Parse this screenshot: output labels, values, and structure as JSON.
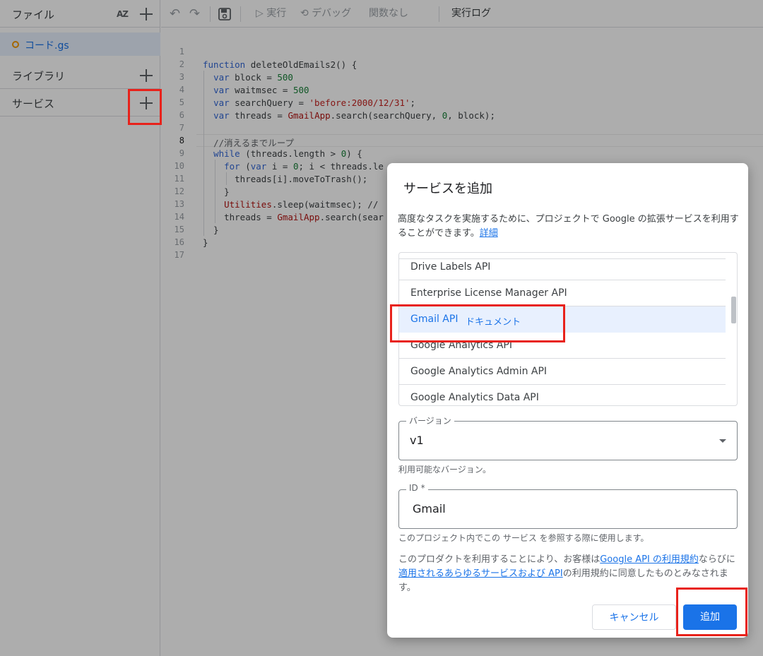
{
  "sidebar": {
    "files_title": "ファイル",
    "sort_icon": "AZ",
    "file_name": "コード.gs",
    "libraries_title": "ライブラリ",
    "services_title": "サービス"
  },
  "toolbar": {
    "run_label": "実行",
    "debug_label": "デバッグ",
    "function_label": "関数なし",
    "log_label": "実行ログ"
  },
  "editor": {
    "line_numbers": [
      "1",
      "2",
      "3",
      "4",
      "5",
      "6",
      "7",
      "8",
      "9",
      "10",
      "11",
      "12",
      "13",
      "14",
      "15",
      "16",
      "17"
    ]
  },
  "dialog": {
    "title": "サービスを追加",
    "description": "高度なタスクを実施するために、プロジェクトで Google の拡張サービスを利用することができます。",
    "details_link": "詳細",
    "apis": [
      "Drive Labels API",
      "Enterprise License Manager API",
      "Gmail API",
      "Google Analytics API",
      "Google Analytics Admin API",
      "Google Analytics Data API"
    ],
    "selected_doc_link": "ドキュメント",
    "version_label": "バージョン",
    "version_value": "v1",
    "version_helper": "利用可能なバージョン。",
    "id_label": "ID *",
    "id_value": "Gmail",
    "id_helper": "このプロジェクト内でこの サービス を参照する際に使用します。",
    "terms_prefix": "このプロダクトを利用することにより、お客様は",
    "terms_link1": "Google API の利用規約",
    "terms_mid": "ならびに",
    "terms_link2": "適用されるあらゆるサービスおよび API",
    "terms_suffix": "の利用規約に同意したものとみなされます。",
    "cancel_label": "キャンセル",
    "add_label": "追加"
  },
  "colors": {
    "accent": "#1a73e8",
    "annotation": "#e8221b"
  }
}
